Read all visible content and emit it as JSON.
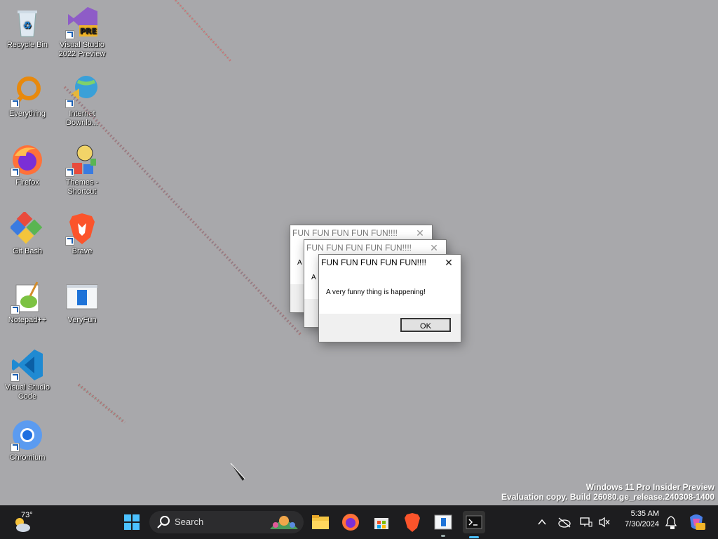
{
  "desktop_icons": [
    {
      "label": "Recycle Bin",
      "icon": "recycle-bin-icon"
    },
    {
      "label": "Visual Studio 2022 Preview",
      "icon": "visual-studio-preview-icon"
    },
    {
      "label": "Everything",
      "icon": "everything-icon"
    },
    {
      "label": "Internet Downlo...",
      "icon": "internet-download-manager-icon"
    },
    {
      "label": "Firefox",
      "icon": "firefox-icon"
    },
    {
      "label": "Themes - Shortcut",
      "icon": "themes-icon"
    },
    {
      "label": "Git Bash",
      "icon": "git-bash-icon"
    },
    {
      "label": "Brave",
      "icon": "brave-icon"
    },
    {
      "label": "Notepad++",
      "icon": "notepad-plus-plus-icon"
    },
    {
      "label": "VeryFun",
      "icon": "veryfun-icon"
    },
    {
      "label": "Visual Studio Code",
      "icon": "vscode-icon"
    },
    {
      "label": "Chromium",
      "icon": "chromium-icon"
    }
  ],
  "badges": {
    "pre": "PRE"
  },
  "dialogs": [
    {
      "title": "FUN FUN FUN FUN FUN!!!!",
      "message_partial": "A",
      "state": "inactive"
    },
    {
      "title": "FUN FUN FUN FUN FUN!!!!",
      "message_partial": "A",
      "state": "inactive"
    },
    {
      "title": "FUN FUN FUN FUN FUN!!!!",
      "message": "A very funny thing is happening!",
      "button": "OK",
      "close_glyph": "✕",
      "state": "active"
    }
  ],
  "watermark": {
    "line1": "Windows 11 Pro Insider Preview",
    "line2": "Evaluation copy. Build 26080.ge_release.240308-1400"
  },
  "taskbar": {
    "weather": "73°",
    "search_label": "Search",
    "pinned": [
      "start-icon",
      "search-icon",
      "file-explorer-icon",
      "firefox-icon",
      "microsoft-store-icon",
      "brave-icon",
      "veryfun-icon",
      "terminal-icon"
    ],
    "time": "5:35 AM",
    "date": "7/30/2024",
    "colors": {
      "bg": "#1d1d1f",
      "desktop": "#a8a8ab"
    }
  }
}
